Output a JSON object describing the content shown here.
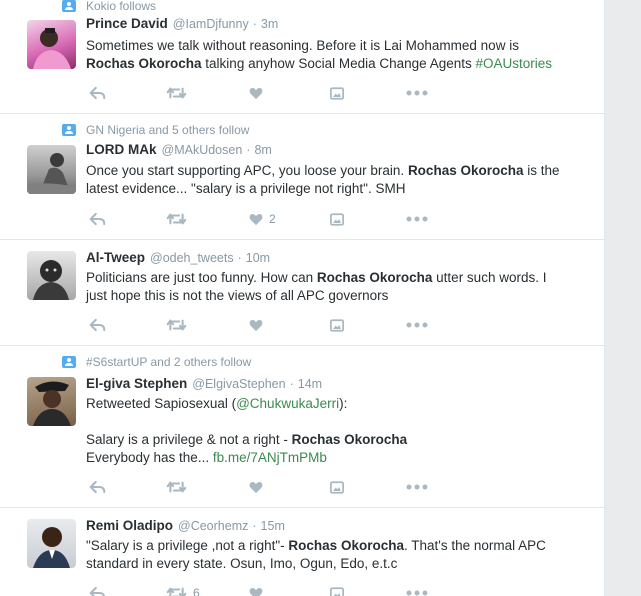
{
  "tweets": [
    {
      "context": "Kokio follows",
      "name": "Prince David",
      "handle": "@IamDjfunny",
      "time": "3m",
      "line1": "Sometimes we talk without reasoning. Before it is Lai Mohammed now is",
      "bold": "Rochas Okorocha",
      "line2_rest": " talking anyhow Social Media Change Agents ",
      "hashtag": "#OAUstories",
      "like_count": ""
    },
    {
      "context": "GN Nigeria and 5 others follow",
      "name": "LORD MAk",
      "handle": "@MAkUdosen",
      "time": "8m",
      "line1_pre": "Once you start supporting APC, you loose your brain. ",
      "bold": "Rochas Okorocha",
      "line1_post": " is the",
      "line2": "latest evidence... \"salary is a privilege not right\". SMH",
      "like_count": "2"
    },
    {
      "name": "Al-Tweep",
      "handle": "@odeh_tweets",
      "time": "10m",
      "line1_pre": "Politicians are just too funny. How can ",
      "bold": "Rochas Okorocha",
      "line1_post": " utter such words. I",
      "line2": "just hope this is not the views of all APC governors"
    },
    {
      "context": "#S6startUP and 2 others follow",
      "name": "El-giva Stephen",
      "handle": "@ElgivaStephen",
      "time": "14m",
      "line1_pre": "Retweeted Sapiosexual (",
      "mention": "@ChukwukaJerri",
      "line1_post": "):",
      "line3_pre": "Salary is a privilege & not a right - ",
      "bold": "Rochas Okorocha",
      "line4_pre": "Everybody has the... ",
      "url": "fb.me/7ANjTmPMb"
    },
    {
      "name": "Remi Oladipo",
      "handle": "@Ceorhemz",
      "time": "15m",
      "line1_pre": "\"Salary is a privilege ,not a right\"- ",
      "bold": "Rochas Okorocha",
      "line1_post": ". That's the normal APC",
      "line2": "standard in every state. Osun, Imo, Ogun, Edo, e.t.c",
      "retweet_count": "6"
    }
  ],
  "separator": "·",
  "icons": [
    "person-icon",
    "reply-icon",
    "retweet-icon",
    "heart-icon",
    "media-icon",
    "more-icon"
  ],
  "colors": {
    "link": "#2b7bb9",
    "hashtag": "#3b8a4e",
    "meta": "#8899a6",
    "action": "#aab8c2"
  }
}
